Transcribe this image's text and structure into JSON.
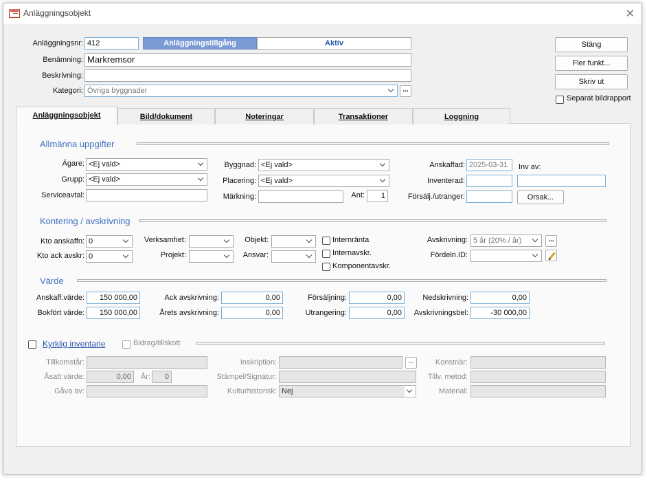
{
  "window": {
    "title": "Anläggningsobjekt",
    "close_glyph": "✕"
  },
  "header": {
    "anl_nr_label": "Anläggningsnr:",
    "anl_nr_value": "412",
    "type_label": "Anläggningstillgång",
    "status_label": "Aktiv",
    "benamning_label": "Benämning:",
    "benamning_value": "Markremsor",
    "beskrivning_label": "Beskrivning:",
    "beskrivning_value": "",
    "kategori_label": "Kategori:",
    "kategori_value": "Övriga byggnader",
    "more_glyph": "..."
  },
  "side_buttons": {
    "stang_label": "Stäng",
    "fler_label": "Fler funkt...",
    "skriv_label": "Skriv ut",
    "separat_label": "Separat bildrapport"
  },
  "tabs": [
    {
      "label": "Anläggningsobjekt"
    },
    {
      "label": "Bild/dokument"
    },
    {
      "label": "Noteringar"
    },
    {
      "label": "Transaktioner"
    },
    {
      "label": "Loggning"
    }
  ],
  "allmanna": {
    "title": "Allmänna uppgifter",
    "agare_label": "Ägare:",
    "agare_value": "<Ej vald>",
    "grupp_label": "Grupp:",
    "grupp_value": "<Ej vald>",
    "serviceavtal_label": "Serviceavtal:",
    "serviceavtal_value": "",
    "byggnad_label": "Byggnad:",
    "byggnad_value": "<Ej vald>",
    "placering_label": "Placering:",
    "placering_value": "<Ej vald>",
    "markning_label": "Märkning:",
    "markning_value": "",
    "ant_label": "Ant:",
    "ant_value": "1",
    "anskaffad_label": "Anskaffad:",
    "anskaffad_value": "2025-03-31",
    "inv_av_label": "Inv av:",
    "inv_av_value": "",
    "inventerad_label": "Inventerad:",
    "inventerad_value": "",
    "forsalj_label": "Försälj./utranger:",
    "forsalj_value": "",
    "orsak_label": "Orsak..."
  },
  "kontering": {
    "title": "Kontering / avskrivning",
    "kto_anskaffn_label": "Kto anskaffn:",
    "kto_anskaffn_value": "0",
    "kto_ack_label": "Kto ack avskr:",
    "kto_ack_value": "0",
    "verksamhet_label": "Verksamhet:",
    "verksamhet_value": "",
    "projekt_label": "Projekt:",
    "projekt_value": "",
    "objekt_label": "Objekt:",
    "objekt_value": "",
    "ansvar_label": "Ansvar:",
    "ansvar_value": "",
    "internranta_label": "Internränta",
    "internavskr_label": "Internavskr.",
    "komponent_label": "Komponentavskr.",
    "avskrivning_label": "Avskrivning:",
    "avskrivning_value": "5 år (20% / år)",
    "fordeln_label": "Fördeln.ID:",
    "fordeln_value": ""
  },
  "varde": {
    "title": "Värde",
    "anskaff_label": "Anskaff.värde:",
    "anskaff_value": "150 000,00",
    "bokfort_label": "Bokfört värde:",
    "bokfort_value": "150 000,00",
    "ack_avskr_label": "Ack avskrivning:",
    "ack_avskr_value": "0,00",
    "arets_avskr_label": "Årets avskrivning:",
    "arets_avskr_value": "0,00",
    "forsaljning_label": "Försäljning:",
    "forsaljning_value": "0,00",
    "utrangering_label": "Utrangering:",
    "utrangering_value": "0,00",
    "nedskrivning_label": "Nedskrivning:",
    "nedskrivning_value": "0,00",
    "avskrivningsbel_label": "Avskrivningsbel:",
    "avskrivningsbel_value": "-30 000,00"
  },
  "kyrklig": {
    "title": "Kyrklig inventarie",
    "bidrag_label": "Bidrag/tillskott",
    "tillkomstar_label": "Tillkomstår:",
    "tillkomstar_value": "",
    "asatt_label": "Åsatt värde:",
    "asatt_value": "0,00",
    "ar_label": "År:",
    "ar_value": "0",
    "gava_label": "Gåva av:",
    "gava_value": "",
    "inskription_label": "Inskription:",
    "inskription_value": "",
    "stampel_label": "Stämpel/Signatur:",
    "stampel_value": "",
    "kulturhist_label": "Kulturhistorisk:",
    "kulturhist_value": "Nej",
    "konstnar_label": "Konstnär:",
    "konstnar_value": "",
    "tillv_label": "Tillv. metod:",
    "tillv_value": "",
    "material_label": "Material:",
    "material_value": ""
  },
  "colors": {
    "accent_blue": "#3f6fbf",
    "type_badge_bg": "#7b9bd6"
  }
}
